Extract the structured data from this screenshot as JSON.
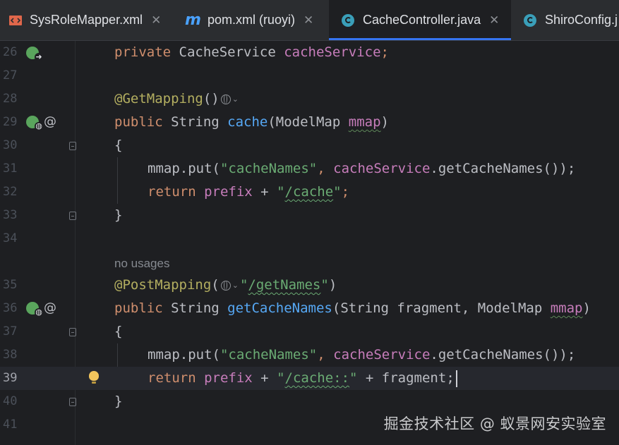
{
  "tabs": [
    {
      "label": "SysRoleMapper.xml",
      "icon": "xml-file-icon",
      "active": false
    },
    {
      "label": "pom.xml (ruoyi)",
      "icon": "maven-icon",
      "active": false
    },
    {
      "label": "CacheController.java",
      "icon": "java-class-icon",
      "active": true
    },
    {
      "label": "ShiroConfig.j",
      "icon": "java-class-icon",
      "active": false
    }
  ],
  "close_glyph": "✕",
  "lines": {
    "l26": {
      "num": "26",
      "t1": "private",
      "t2": " CacheService ",
      "t3": "cacheService",
      "t4": ";"
    },
    "l27": {
      "num": "27"
    },
    "l28": {
      "num": "28",
      "t1": "@GetMapping",
      "t2": "()"
    },
    "l29": {
      "num": "29",
      "t1": "public",
      "t2": " String ",
      "t3": "cache",
      "t4": "(ModelMap ",
      "t5": "mmap",
      "t6": ")"
    },
    "l30": {
      "num": "30",
      "t1": "{"
    },
    "l31": {
      "num": "31",
      "t1": "mmap.put(",
      "t2": "\"cacheNames\"",
      "t3": ", ",
      "t4": "cacheService",
      "t5": ".getCacheNames());"
    },
    "l32": {
      "num": "32",
      "t1": "return",
      "t2": " ",
      "t3": "prefix",
      "t4": " + ",
      "t5": "\"",
      "t6": "/cache",
      "t7": "\"",
      "t8": ";"
    },
    "l33": {
      "num": "33",
      "t1": "}"
    },
    "l34": {
      "num": "34"
    },
    "usage_hint": "no usages",
    "l35": {
      "num": "35",
      "t1": "@PostMapping",
      "t2": "(",
      "t3": "\"",
      "t4": "/getNames",
      "t5": "\"",
      "t6": ")"
    },
    "l36": {
      "num": "36",
      "t1": "public",
      "t2": " String ",
      "t3": "getCacheNames",
      "t4": "(String fragment, ModelMap ",
      "t5": "mmap",
      "t6": ")"
    },
    "l37": {
      "num": "37",
      "t1": "{"
    },
    "l38": {
      "num": "38",
      "t1": "mmap.put(",
      "t2": "\"cacheNames\"",
      "t3": ", ",
      "t4": "cacheService",
      "t5": ".getCacheNames());"
    },
    "l39": {
      "num": "39",
      "t1": "return",
      "t2": " ",
      "t3": "prefix",
      "t4": " + ",
      "t5": "\"",
      "t6": "/cache::",
      "t7": "\"",
      "t8": " + fragment;"
    },
    "l40": {
      "num": "40",
      "t1": "}"
    },
    "l41": {
      "num": "41"
    }
  },
  "chevron": "⌄",
  "watermark": "掘金技术社区 @ 蚁景网安实验室",
  "colors": {
    "keyword": "#cf8e6d",
    "field": "#c77dbb",
    "annotation": "#b3ae60",
    "method": "#56a8f5",
    "string": "#6aab73",
    "active_tab_underline": "#3574f0"
  }
}
